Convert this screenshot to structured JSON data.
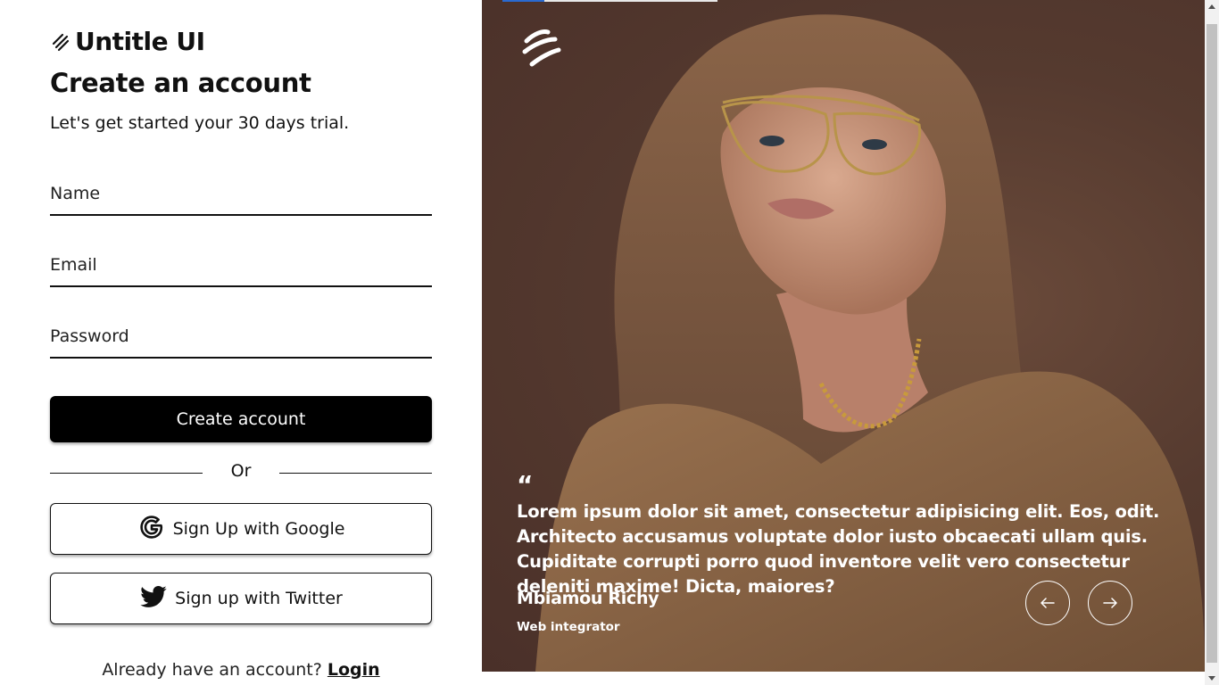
{
  "brand": {
    "name": "Untitle UI",
    "icon": "double-slash-logo-icon"
  },
  "form": {
    "title": "Create an account",
    "subtitle": "Let's get started your 30 days trial.",
    "name_placeholder": "Name",
    "email_placeholder": "Email",
    "password_placeholder": "Password",
    "submit_label": "Create account",
    "divider_label": "Or",
    "google_label": "Sign Up with Google",
    "twitter_label": "Sign up with Twitter",
    "login_prompt": "Already have an account?",
    "login_link": "Login"
  },
  "testimonial": {
    "quote_mark": "“",
    "quote": "Lorem ipsum dolor sit amet, consectetur adipisicing elit. Eos, odit. Architecto accusamus voluptate dolor iusto obcaecati ullam quis. Cupiditate corrupti porro quod inventore velit vero consectetur deleniti maxime! Dicta, maiores?",
    "author": "Mbiamou Richy",
    "role": "Web integrator",
    "prev_icon": "arrow-left-icon",
    "next_icon": "arrow-right-icon"
  },
  "colors": {
    "primary_button": "#000000",
    "panel_bg": "#553a2f",
    "progress_fill": "#2a6ad0"
  }
}
